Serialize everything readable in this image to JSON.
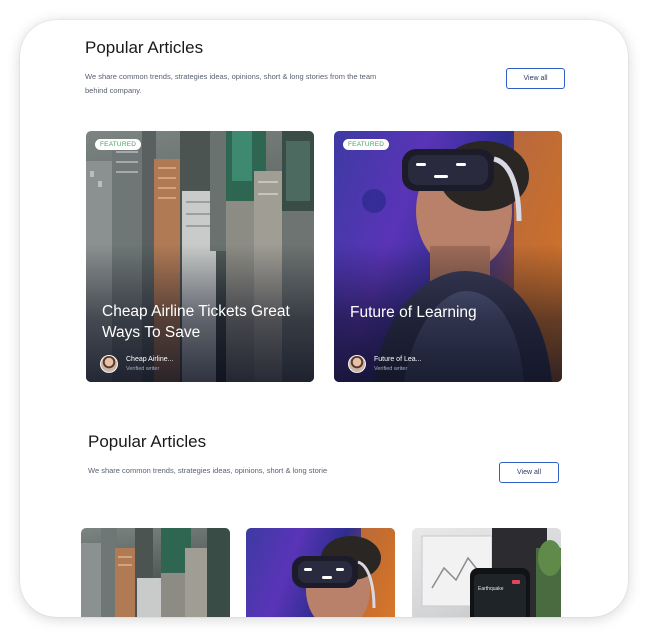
{
  "section1": {
    "title": "Popular Articles",
    "subtitle": "We share common trends, strategies ideas, opinions, short & long stories from the team behind company.",
    "view_all": "View all"
  },
  "cards": [
    {
      "badge": "FEATURED",
      "title": "Cheap Airline Tickets Great Ways To Save",
      "author": "Cheap Airline...",
      "role": "Verified writer"
    },
    {
      "badge": "FEATURED",
      "title": "Future of Learning",
      "author": "Future of Lea...",
      "role": "Verified writer"
    }
  ],
  "section2": {
    "title": "Popular Articles",
    "subtitle": "We share common trends, strategies ideas, opinions, short & long storie",
    "view_all": "View all"
  },
  "phone": {
    "screen_title": "Earthquake"
  },
  "colors": {
    "accent": "#2f5fc4",
    "badge_text": "#3fa65c",
    "card_overlay": "#0a0e1e"
  }
}
